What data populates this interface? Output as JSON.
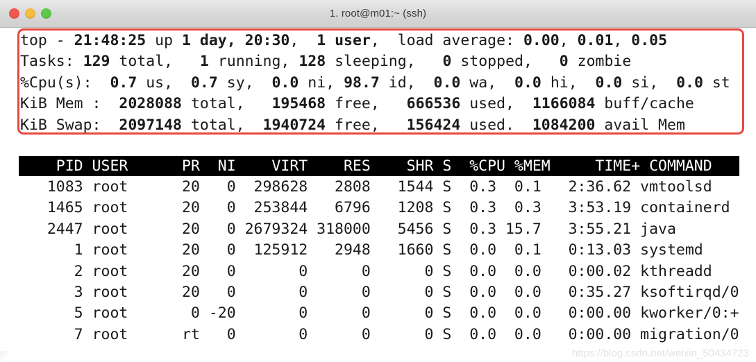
{
  "window": {
    "title": "1. root@m01:~ (ssh)",
    "traffic_lights": [
      {
        "name": "close",
        "color": "#f0584f"
      },
      {
        "name": "minimize",
        "color": "#f6bc3f"
      },
      {
        "name": "maximize",
        "color": "#5dc94a"
      }
    ]
  },
  "annotation": {
    "highlight_color": "#e8463f",
    "target": "summary-block"
  },
  "summary": {
    "uptime_line": {
      "program": "top",
      "time": "21:48:25",
      "up": "1 day, 20:30",
      "users": "1 user",
      "load_average": [
        "0.00",
        "0.01",
        "0.05"
      ],
      "text": "top - 21:48:25 up 1 day, 20:30,  1 user,  load average: 0.00, 0.01, 0.05"
    },
    "tasks_line": {
      "label": "Tasks:",
      "total": "129",
      "running": "1",
      "sleeping": "128",
      "stopped": "0",
      "zombie": "0"
    },
    "cpu_line": {
      "label": "%Cpu(s):",
      "us": "0.7",
      "sy": "0.7",
      "ni": "0.0",
      "id": "98.7",
      "wa": "0.0",
      "hi": "0.0",
      "si": "0.0",
      "st": "0.0"
    },
    "mem_line": {
      "label": "KiB Mem :",
      "total": "2028088",
      "free": "195468",
      "used": "666536",
      "buff_cache": "1166084"
    },
    "swap_line": {
      "label": "KiB Swap:",
      "total": "2097148",
      "free": "1940724",
      "used": "156424",
      "avail_mem": "1084200"
    }
  },
  "table": {
    "columns": [
      "PID",
      "USER",
      "PR",
      "NI",
      "VIRT",
      "RES",
      "SHR",
      "S",
      "%CPU",
      "%MEM",
      "TIME+",
      "COMMAND"
    ],
    "header_text": "    PID USER      PR  NI    VIRT    RES    SHR S  %CPU %MEM     TIME+ COMMAND",
    "rows": [
      {
        "PID": "1083",
        "USER": "root",
        "PR": "20",
        "NI": "0",
        "VIRT": "298628",
        "RES": "2808",
        "SHR": "1544",
        "S": "S",
        "%CPU": "0.3",
        "%MEM": "0.1",
        "TIME+": "2:36.62",
        "COMMAND": "vmtoolsd"
      },
      {
        "PID": "1465",
        "USER": "root",
        "PR": "20",
        "NI": "0",
        "VIRT": "253844",
        "RES": "6796",
        "SHR": "1208",
        "S": "S",
        "%CPU": "0.3",
        "%MEM": "0.3",
        "TIME+": "3:53.19",
        "COMMAND": "containerd"
      },
      {
        "PID": "2447",
        "USER": "root",
        "PR": "20",
        "NI": "0",
        "VIRT": "2679324",
        "RES": "318000",
        "SHR": "5456",
        "S": "S",
        "%CPU": "0.3",
        "%MEM": "15.7",
        "TIME+": "3:55.21",
        "COMMAND": "java"
      },
      {
        "PID": "1",
        "USER": "root",
        "PR": "20",
        "NI": "0",
        "VIRT": "125912",
        "RES": "2948",
        "SHR": "1660",
        "S": "S",
        "%CPU": "0.0",
        "%MEM": "0.1",
        "TIME+": "0:13.03",
        "COMMAND": "systemd"
      },
      {
        "PID": "2",
        "USER": "root",
        "PR": "20",
        "NI": "0",
        "VIRT": "0",
        "RES": "0",
        "SHR": "0",
        "S": "S",
        "%CPU": "0.0",
        "%MEM": "0.0",
        "TIME+": "0:00.02",
        "COMMAND": "kthreadd"
      },
      {
        "PID": "3",
        "USER": "root",
        "PR": "20",
        "NI": "0",
        "VIRT": "0",
        "RES": "0",
        "SHR": "0",
        "S": "S",
        "%CPU": "0.0",
        "%MEM": "0.0",
        "TIME+": "0:35.27",
        "COMMAND": "ksoftirqd/0"
      },
      {
        "PID": "5",
        "USER": "root",
        "PR": "0",
        "NI": "-20",
        "VIRT": "0",
        "RES": "0",
        "SHR": "0",
        "S": "S",
        "%CPU": "0.0",
        "%MEM": "0.0",
        "TIME+": "0:00.00",
        "COMMAND": "kworker/0:+"
      },
      {
        "PID": "7",
        "USER": "root",
        "PR": "rt",
        "NI": "0",
        "VIRT": "0",
        "RES": "0",
        "SHR": "0",
        "S": "S",
        "%CPU": "0.0",
        "%MEM": "0.0",
        "TIME+": "0:00.00",
        "COMMAND": "migration/0"
      }
    ]
  },
  "watermark": {
    "text": "https://blog.csdn.net/weixin_50434723"
  }
}
